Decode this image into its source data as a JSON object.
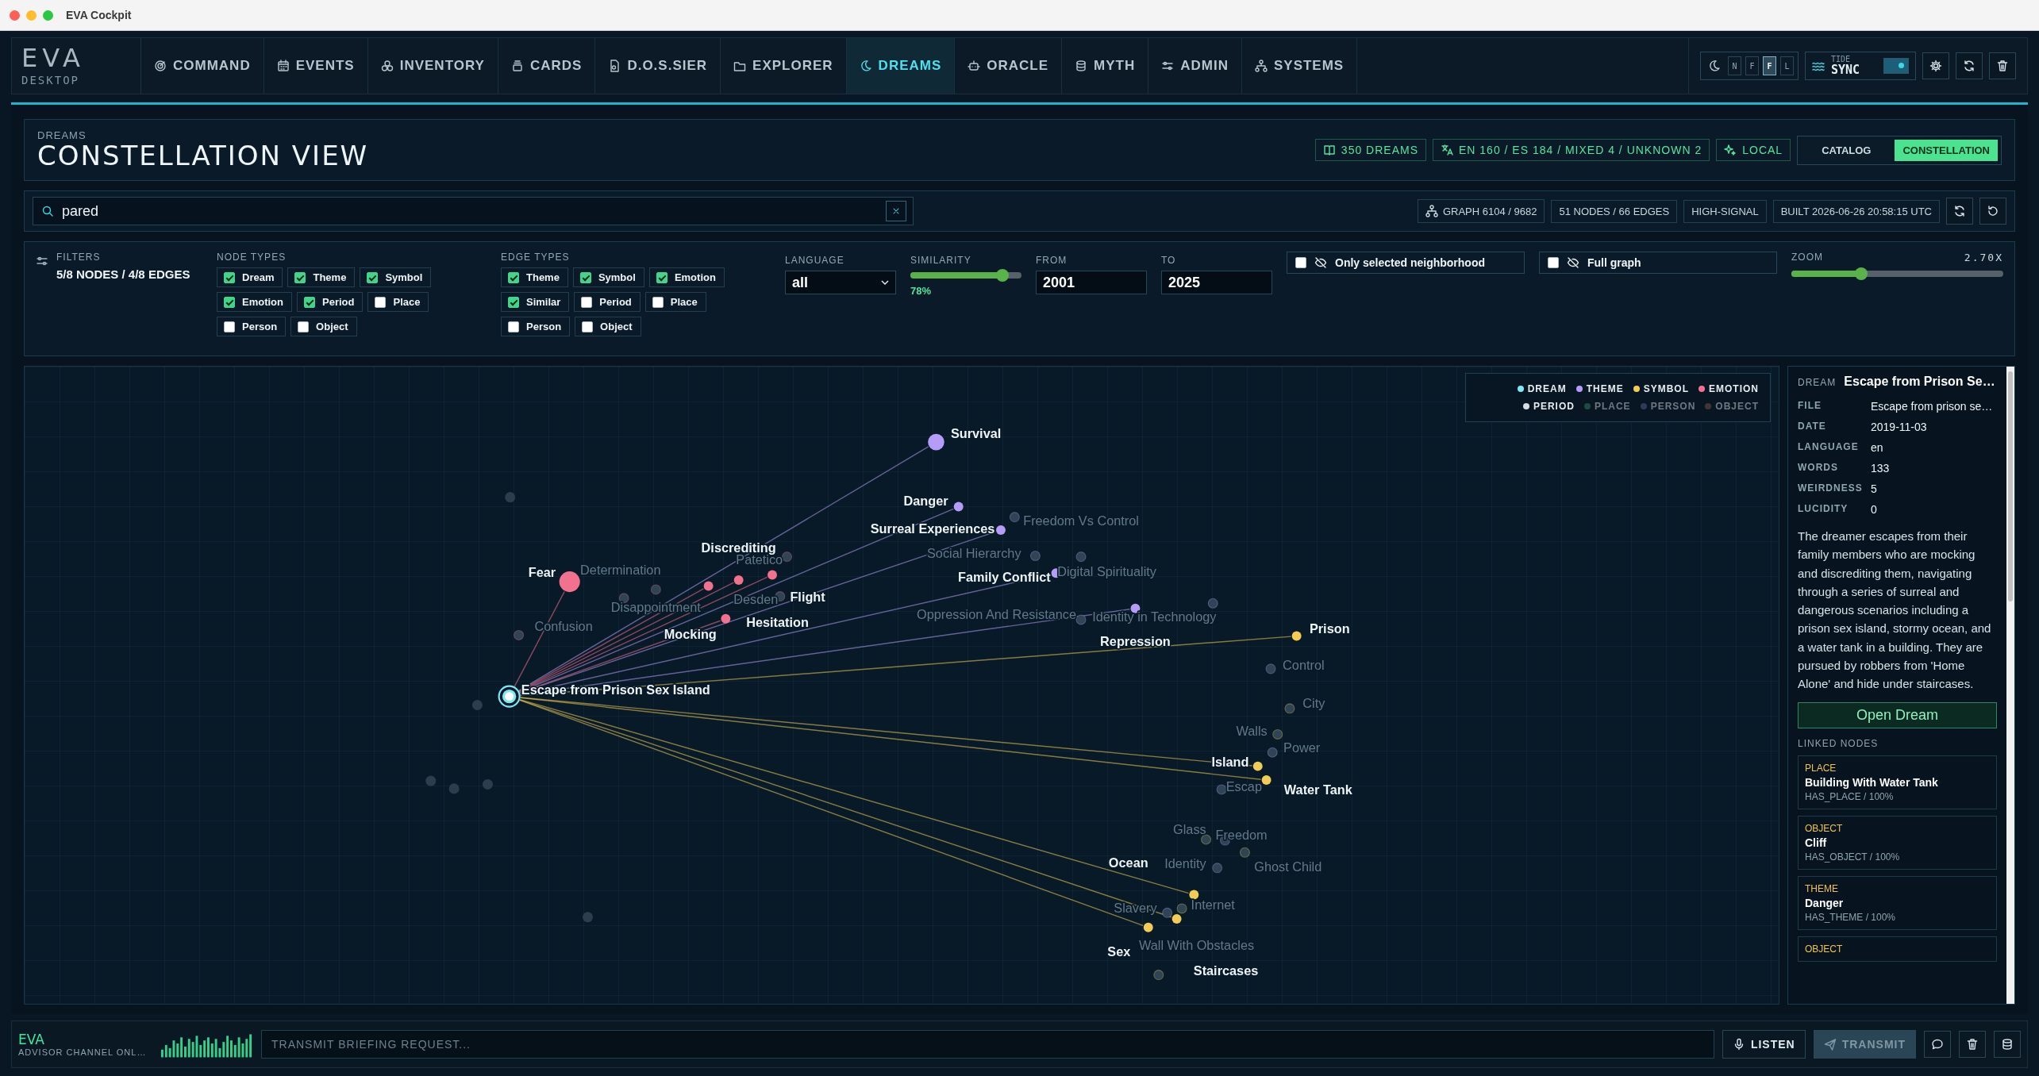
{
  "window": {
    "title": "EVA Cockpit"
  },
  "logo": {
    "title": "EVA",
    "subtitle": "DESKTOP"
  },
  "nav": [
    {
      "label": "COMMAND",
      "selected": false
    },
    {
      "label": "EVENTS",
      "selected": false
    },
    {
      "label": "INVENTORY",
      "selected": false
    },
    {
      "label": "CARDS",
      "selected": false
    },
    {
      "label": "D.O.S.SIER",
      "selected": false
    },
    {
      "label": "EXPLORER",
      "selected": false
    },
    {
      "label": "DREAMS",
      "selected": true
    },
    {
      "label": "ORACLE",
      "selected": false
    },
    {
      "label": "MYTH",
      "selected": false
    },
    {
      "label": "ADMIN",
      "selected": false
    },
    {
      "label": "SYSTEMS",
      "selected": false
    }
  ],
  "mode_options": [
    {
      "label": "N",
      "selected": false
    },
    {
      "label": "F",
      "selected": false
    },
    {
      "label": "F",
      "selected": true
    },
    {
      "label": "L",
      "selected": false
    }
  ],
  "tide": {
    "label": "TIDE",
    "value": "SYNC",
    "on": true
  },
  "header": {
    "eyebrow": "DREAMS",
    "title": "CONSTELLATION VIEW",
    "badges": [
      {
        "kind": "book",
        "label": "350 DREAMS"
      },
      {
        "kind": "translate",
        "label": "EN 160 / ES 184 / MIXED 4 / UNKNOWN 2"
      },
      {
        "kind": "sparkle",
        "label": "LOCAL"
      }
    ],
    "view_tabs": [
      {
        "label": "CATALOG",
        "selected": false
      },
      {
        "label": "CONSTELLATION",
        "selected": true
      }
    ]
  },
  "search": {
    "value": "pared",
    "stats": [
      {
        "kind": "graph",
        "label": "GRAPH 6104 / 9682"
      },
      {
        "kind": "plain",
        "label": "51 NODES / 66 EDGES"
      },
      {
        "kind": "plain",
        "label": "HIGH-SIGNAL"
      },
      {
        "kind": "plain",
        "label": "BUILT 2026-06-26 20:58:15 UTC"
      }
    ]
  },
  "filters": {
    "label": "FILTERS",
    "summary": "5/8 NODES / 4/8 EDGES",
    "node_types": {
      "title": "NODE TYPES",
      "items": [
        {
          "label": "Dream",
          "checked": true
        },
        {
          "label": "Theme",
          "checked": true
        },
        {
          "label": "Symbol",
          "checked": true
        },
        {
          "label": "Emotion",
          "checked": true
        },
        {
          "label": "Period",
          "checked": true
        },
        {
          "label": "Place",
          "checked": false
        },
        {
          "label": "Person",
          "checked": false
        },
        {
          "label": "Object",
          "checked": false
        }
      ]
    },
    "edge_types": {
      "title": "EDGE TYPES",
      "items": [
        {
          "label": "Theme",
          "checked": true
        },
        {
          "label": "Symbol",
          "checked": true
        },
        {
          "label": "Emotion",
          "checked": true
        },
        {
          "label": "Similar",
          "checked": true
        },
        {
          "label": "Period",
          "checked": false
        },
        {
          "label": "Place",
          "checked": false
        },
        {
          "label": "Person",
          "checked": false
        },
        {
          "label": "Object",
          "checked": false
        }
      ]
    },
    "language": {
      "label": "LANGUAGE",
      "value": "all"
    },
    "similarity": {
      "label": "SIMILARITY",
      "level": 0.83,
      "reading": "78%"
    },
    "from": {
      "label": "FROM",
      "value": "2001"
    },
    "to": {
      "label": "TO",
      "value": "2025"
    },
    "toggles": [
      {
        "label": "Only selected neighborhood",
        "checked": false
      },
      {
        "label": "Full graph",
        "checked": false
      }
    ],
    "zoom": {
      "label": "ZOOM",
      "reading": "2.70X",
      "level": 0.33
    }
  },
  "graph": {
    "legend": [
      {
        "label": "DREAM",
        "kind": "dream",
        "active": true
      },
      {
        "label": "THEME",
        "kind": "theme",
        "active": true
      },
      {
        "label": "SYMBOL",
        "kind": "symbol",
        "active": true
      },
      {
        "label": "EMOTION",
        "kind": "emotion",
        "active": true
      },
      {
        "label": "PERIOD",
        "kind": "period",
        "active": true
      },
      {
        "label": "PLACE",
        "kind": "place",
        "active": false
      },
      {
        "label": "PERSON",
        "kind": "person",
        "active": false
      },
      {
        "label": "OBJECT",
        "kind": "object",
        "active": false
      }
    ],
    "nodes": [
      {
        "label": "Escape from Prison Sex Island",
        "kind": "dream",
        "highlighted": true,
        "selected": true
      },
      {
        "label": "Survival",
        "kind": "theme",
        "highlighted": true,
        "selected": false
      },
      {
        "label": "Danger",
        "kind": "theme",
        "highlighted": true,
        "selected": false
      },
      {
        "label": "Surreal Experiences",
        "kind": "theme",
        "highlighted": true,
        "selected": false
      },
      {
        "label": "Freedom Vs Control",
        "kind": "theme",
        "highlighted": false,
        "selected": false
      },
      {
        "label": "Discrediting",
        "kind": "emotion",
        "highlighted": true,
        "selected": false
      },
      {
        "label": "Hesitation",
        "kind": "emotion",
        "highlighted": true,
        "selected": false
      },
      {
        "label": "Flight",
        "kind": "emotion",
        "highlighted": true,
        "selected": false
      },
      {
        "label": "Mocking",
        "kind": "emotion",
        "highlighted": true,
        "selected": false
      },
      {
        "label": "Fear",
        "kind": "emotion",
        "highlighted": true,
        "selected": false
      },
      {
        "label": "Determination",
        "kind": "emotion",
        "highlighted": false,
        "selected": false
      },
      {
        "label": "Disappointment",
        "kind": "emotion",
        "highlighted": false,
        "selected": false
      },
      {
        "label": "Confusion",
        "kind": "emotion",
        "highlighted": false,
        "selected": false
      },
      {
        "label": "Patetico",
        "kind": "emotion",
        "highlighted": false,
        "selected": false
      },
      {
        "label": "Desden",
        "kind": "emotion",
        "highlighted": false,
        "selected": false
      },
      {
        "label": "Social Hierarchy",
        "kind": "theme",
        "highlighted": false,
        "selected": false
      },
      {
        "label": "Family Conflict",
        "kind": "theme",
        "highlighted": true,
        "selected": false
      },
      {
        "label": "Digital Spirituality",
        "kind": "theme",
        "highlighted": false,
        "selected": false
      },
      {
        "label": "Oppression And Resistance",
        "kind": "theme",
        "highlighted": false,
        "selected": false
      },
      {
        "label": "Identity in Technology",
        "kind": "theme",
        "highlighted": false,
        "selected": false
      },
      {
        "label": "Repression",
        "kind": "theme",
        "highlighted": true,
        "selected": false
      },
      {
        "label": "Prison",
        "kind": "symbol",
        "highlighted": true,
        "selected": false
      },
      {
        "label": "Control",
        "kind": "theme",
        "highlighted": false,
        "selected": false
      },
      {
        "label": "City",
        "kind": "symbol",
        "highlighted": false,
        "selected": false
      },
      {
        "label": "Walls",
        "kind": "symbol",
        "highlighted": false,
        "selected": false
      },
      {
        "label": "Power",
        "kind": "theme",
        "highlighted": false,
        "selected": false
      },
      {
        "label": "Island",
        "kind": "symbol",
        "highlighted": true,
        "selected": false
      },
      {
        "label": "Water Tank",
        "kind": "symbol",
        "highlighted": true,
        "selected": false
      },
      {
        "label": "Escap",
        "kind": "theme",
        "highlighted": false,
        "selected": false
      },
      {
        "label": "Glass",
        "kind": "symbol",
        "highlighted": false,
        "selected": false
      },
      {
        "label": "Freedom",
        "kind": "theme",
        "highlighted": false,
        "selected": false
      },
      {
        "label": "Identity",
        "kind": "theme",
        "highlighted": false,
        "selected": false
      },
      {
        "label": "Ghost Child",
        "kind": "symbol",
        "highlighted": false,
        "selected": false
      },
      {
        "label": "Ocean",
        "kind": "symbol",
        "highlighted": true,
        "selected": false
      },
      {
        "label": "Slavery",
        "kind": "theme",
        "highlighted": false,
        "selected": false
      },
      {
        "label": "Internet",
        "kind": "symbol",
        "highlighted": false,
        "selected": false
      },
      {
        "label": "Staircases",
        "kind": "symbol",
        "highlighted": true,
        "selected": false
      },
      {
        "label": "Sex",
        "kind": "symbol",
        "highlighted": true,
        "selected": false
      },
      {
        "label": "Wall With Obstacles",
        "kind": "symbol",
        "highlighted": false,
        "selected": false
      }
    ]
  },
  "details": {
    "kind_label": "DREAM",
    "title": "Escape from Prison Se…",
    "fields": [
      {
        "label": "FILE",
        "value": "Escape from prison se…"
      },
      {
        "label": "DATE",
        "value": "2019-11-03"
      },
      {
        "label": "LANGUAGE",
        "value": "en"
      },
      {
        "label": "WORDS",
        "value": "133"
      },
      {
        "label": "WEIRDNESS",
        "value": "5"
      },
      {
        "label": "LUCIDITY",
        "value": "0"
      }
    ],
    "summary": "The dreamer escapes from their family members who are mocking and discrediting them, navigating through a series of surreal and dangerous scenarios including a prison sex island, stormy ocean, and a water tank in a building. They are pursued by robbers from 'Home Alone' and hide under staircases.",
    "open_button": "Open Dream",
    "linked_title": "LINKED NODES",
    "linked": [
      {
        "type": "PLACE",
        "name": "Building With Water Tank",
        "relation": "HAS_PLACE / 100%"
      },
      {
        "type": "OBJECT",
        "name": "Cliff",
        "relation": "HAS_OBJECT / 100%"
      },
      {
        "type": "THEME",
        "name": "Danger",
        "relation": "HAS_THEME / 100%"
      },
      {
        "type": "OBJECT"
      }
    ]
  },
  "advisor": {
    "name": "EVA",
    "subtitle": "ADVISOR CHANNEL ONL…",
    "placeholder": "TRANSMIT BRIEFING REQUEST...",
    "listen": "LISTEN",
    "transmit": "TRANSMIT"
  }
}
